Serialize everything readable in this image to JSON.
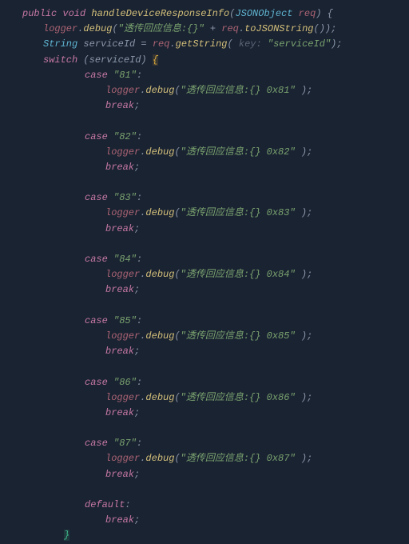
{
  "signature": {
    "modifiers": "public void",
    "name": "handleDeviceResponseInfo",
    "param_type": "JSONObject",
    "param_name": "req"
  },
  "line1": {
    "obj": "logger",
    "method": "debug",
    "str": "\"透传回应信息:{}\"",
    "plus": " + ",
    "obj2": "req",
    "method2": "toJSONString"
  },
  "line2": {
    "type": "String",
    "var": "serviceId",
    "eq": " = ",
    "obj": "req",
    "method": "getString",
    "hint": " key: ",
    "arg": "\"serviceId\""
  },
  "switch_kw": "switch",
  "switch_var": "(serviceId)",
  "case_kw": "case",
  "break_kw": "break",
  "default_kw": "default",
  "logger_obj": "logger",
  "debug_method": "debug",
  "cases": [
    {
      "label": "\"81\"",
      "msg": "\"透传回应信息:{} 0x81\" "
    },
    {
      "label": "\"82\"",
      "msg": "\"透传回应信息:{} 0x82\" "
    },
    {
      "label": "\"83\"",
      "msg": "\"透传回应信息:{} 0x83\" "
    },
    {
      "label": "\"84\"",
      "msg": "\"透传回应信息:{} 0x84\" "
    },
    {
      "label": "\"85\"",
      "msg": "\"透传回应信息:{} 0x85\" "
    },
    {
      "label": "\"86\"",
      "msg": "\"透传回应信息:{} 0x86\" "
    },
    {
      "label": "\"87\"",
      "msg": "\"透传回应信息:{} 0x87\" "
    }
  ]
}
